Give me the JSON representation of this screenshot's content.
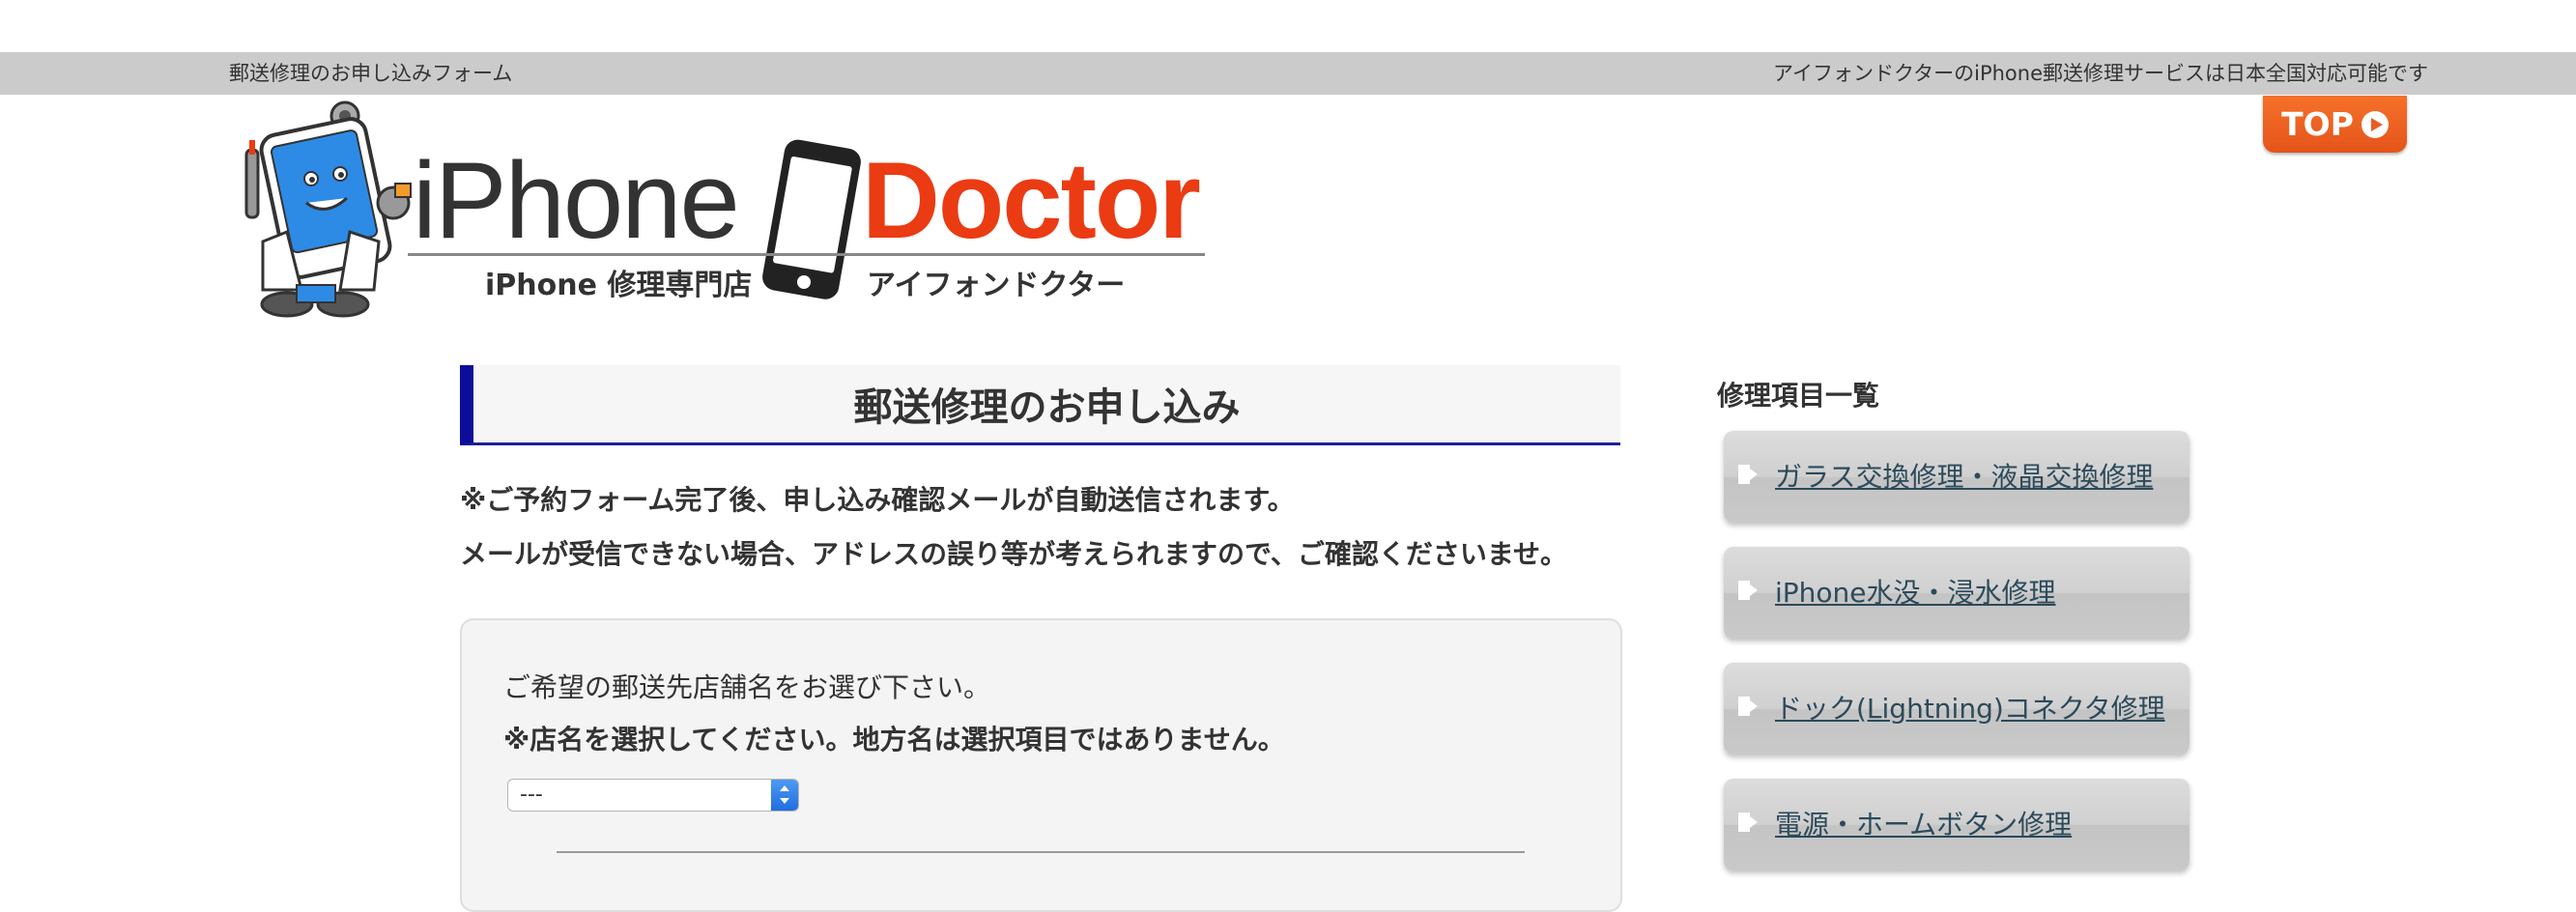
{
  "topbar": {
    "left_text": "郵送修理のお申し込みフォーム",
    "right_text": "アイフォンドクターのiPhone郵送修理サービスは日本全国対応可能です"
  },
  "top_button": {
    "label": "TOP"
  },
  "logo": {
    "word_iphone": "iPhone",
    "word_doctor": "Doctor",
    "sub_left": "iPhone 修理専門店",
    "sub_right": "アイフォンドクター"
  },
  "main": {
    "title": "郵送修理のお申し込み",
    "notice_line1": "※ご予約フォーム完了後、申し込み確認メールが自動送信されます。",
    "notice_line2": "メールが受信できない場合、アドレスの誤り等が考えられますので、ご確認くださいませ。",
    "form": {
      "prompt": "ご希望の郵送先店舗名をお選び下さい。",
      "warning": "※店名を選択してください。地方名は選択項目ではありません。",
      "store_select_value": "---"
    }
  },
  "sidebar": {
    "heading": "修理項目一覧",
    "items": [
      {
        "label": "ガラス交換修理・液晶交換修理"
      },
      {
        "label": "iPhone水没・浸水修理"
      },
      {
        "label": "ドック(Lightning)コネクタ修理"
      },
      {
        "label": "電源・ホームボタン修理"
      }
    ]
  },
  "colors": {
    "accent_blue": "#0d0d9a",
    "brand_red": "#ea3b13",
    "top_button_orange": "#e85e22",
    "topbar_gray": "#cbcbcb"
  }
}
